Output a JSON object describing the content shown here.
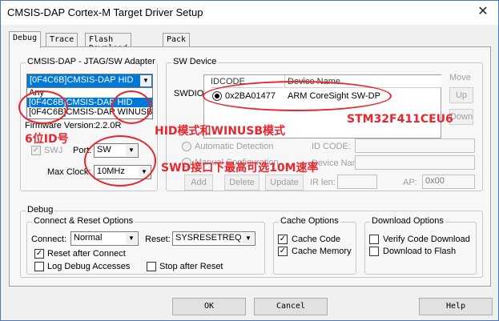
{
  "window": {
    "title": "CMSIS-DAP Cortex-M Target Driver Setup",
    "close_glyph": "✕"
  },
  "tabs": [
    "Debug",
    "Trace",
    "Flash Download",
    "Pack"
  ],
  "adapter": {
    "legend": "CMSIS-DAP - JTAG/SW Adapter",
    "selected": "[0F4C6B]CMSIS-DAP HID",
    "options": [
      "Any",
      "[0F4C6B]CMSIS-DAP HID",
      "[0F4C6B]CMSIS-DAP WINUSB"
    ],
    "firmware_label": "Firmware Version:",
    "firmware_value": "2.2.0R",
    "swj_label": "SWJ",
    "port_label": "Port:",
    "port_value": "SW",
    "clock_label": "Max Clock:",
    "clock_value": "10MHz"
  },
  "swdevice": {
    "legend": "SW Device",
    "swdio_label": "SWDIO",
    "col_idcode": "IDCODE",
    "col_device": "Device Name",
    "row_idcode": "0x2BA01477",
    "row_device": "ARM CoreSight SW-DP",
    "move_label": "Move",
    "up_label": "Up",
    "down_label": "Down",
    "auto_detect": "Automatic Detection",
    "manual_config": "Manual Configuration",
    "idcode_label": "ID CODE:",
    "devname_label": "Device Name:",
    "add_label": "Add",
    "delete_label": "Delete",
    "update_label": "Update",
    "irlen_label": "IR len:",
    "ap_label": "AP:",
    "ap_value": "0x00"
  },
  "debug": {
    "legend": "Debug",
    "connect_reset_legend": "Connect & Reset Options",
    "connect_label": "Connect:",
    "connect_value": "Normal",
    "reset_label": "Reset:",
    "reset_value": "SYSRESETREQ",
    "reset_after_connect": "Reset after Connect",
    "log_debug": "Log Debug Accesses",
    "stop_after_reset": "Stop after Reset",
    "cache_legend": "Cache Options",
    "cache_code": "Cache Code",
    "cache_memory": "Cache Memory",
    "download_legend": "Download Options",
    "verify_code": "Verify Code Download",
    "download_flash": "Download to Flash"
  },
  "buttons": {
    "ok": "OK",
    "cancel": "Cancel",
    "help": "Help"
  },
  "annotations": {
    "id_note": "6位ID号",
    "hid_note": "HID模式和WINUSB模式",
    "swd_note": "SWD接口下最高可选10M速率",
    "chip_note": "STM32F411CEU6",
    "color": "#e8262d"
  },
  "check_glyph": "✓"
}
